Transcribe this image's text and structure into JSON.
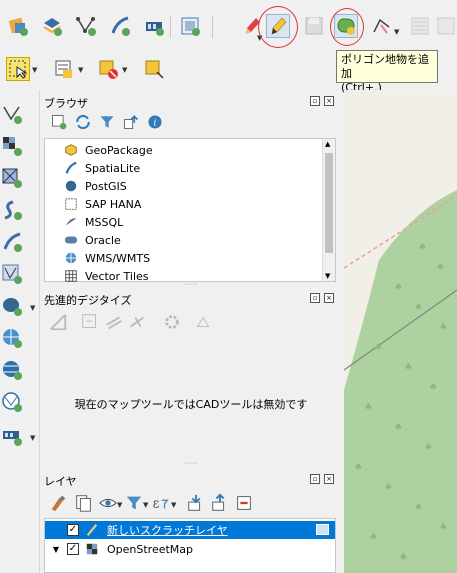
{
  "toolbar_top": {
    "tooltip_title": "ポリゴン地物を追加",
    "tooltip_shortcut": "(Ctrl+.)"
  },
  "browser": {
    "title": "ブラウザ",
    "items": [
      {
        "label": "GeoPackage"
      },
      {
        "label": "SpatiaLite"
      },
      {
        "label": "PostGIS"
      },
      {
        "label": "SAP HANA"
      },
      {
        "label": "MSSQL"
      },
      {
        "label": "Oracle"
      },
      {
        "label": "WMS/WMTS"
      },
      {
        "label": "Vector Tiles"
      }
    ]
  },
  "cad": {
    "title": "先進的デジタイズ",
    "message": "現在のマップツールではCADツールは無効です"
  },
  "layers": {
    "title": "レイヤ",
    "rows": [
      {
        "label": "新しいスクラッチレイヤ",
        "checked": "✓"
      },
      {
        "label": "OpenStreetMap",
        "checked": "✓"
      }
    ]
  },
  "colors": {
    "accent_selection": "#0078d7",
    "map_green": "#aed1a0",
    "annotation_red": "#dd3333"
  }
}
